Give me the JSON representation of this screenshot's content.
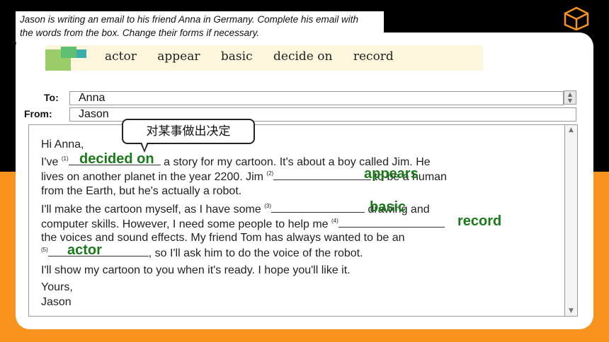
{
  "instruction": {
    "line1": "Jason is writing an email to his friend Anna in Germany. Complete his email with",
    "line2": "the words from the box. Change their forms if necessary."
  },
  "word_box": [
    "actor",
    "appear",
    "basic",
    "decide on",
    "record"
  ],
  "email": {
    "to_label": "To:",
    "to_value": "Anna",
    "from_label": "From:",
    "from_value": "Jason",
    "greeting": "Hi Anna,",
    "l1_a": "I've",
    "l1_b": "a story for my cartoon. It's about a boy called Jim. He",
    "l2_a": "lives on another planet in the year 2200. Jim",
    "l2_b": "to be a human",
    "l3": "from the Earth, but he's actually a robot.",
    "l4_a": "I'll make the cartoon myself, as I have some",
    "l4_b": "drawing and",
    "l5_a": "computer skills. However, I need some people to help me",
    "l6": "the voices and sound effects. My friend Tom has always wanted to be an",
    "l7_b": ", so I'll ask him to do the voice of the robot.",
    "l8": "I'll show my cartoon to you when it's ready. I hope you'll like it.",
    "closing": "Yours,",
    "signature": "Jason",
    "blank_numbers": [
      "(1)",
      "(2)",
      "(3)",
      "(4)",
      "(5)"
    ]
  },
  "answers": [
    "decided on",
    "appears",
    "basic",
    "record",
    "actor"
  ],
  "callout": "对某事做出决定",
  "colors": {
    "answer": "#1a7a1a",
    "accent": "#f7931e",
    "background": "#000000"
  },
  "icons": {
    "logo": "cube-logo-icon",
    "scroll_up": "scroll-up-arrow-icon",
    "scroll_down": "scroll-down-arrow-icon"
  }
}
